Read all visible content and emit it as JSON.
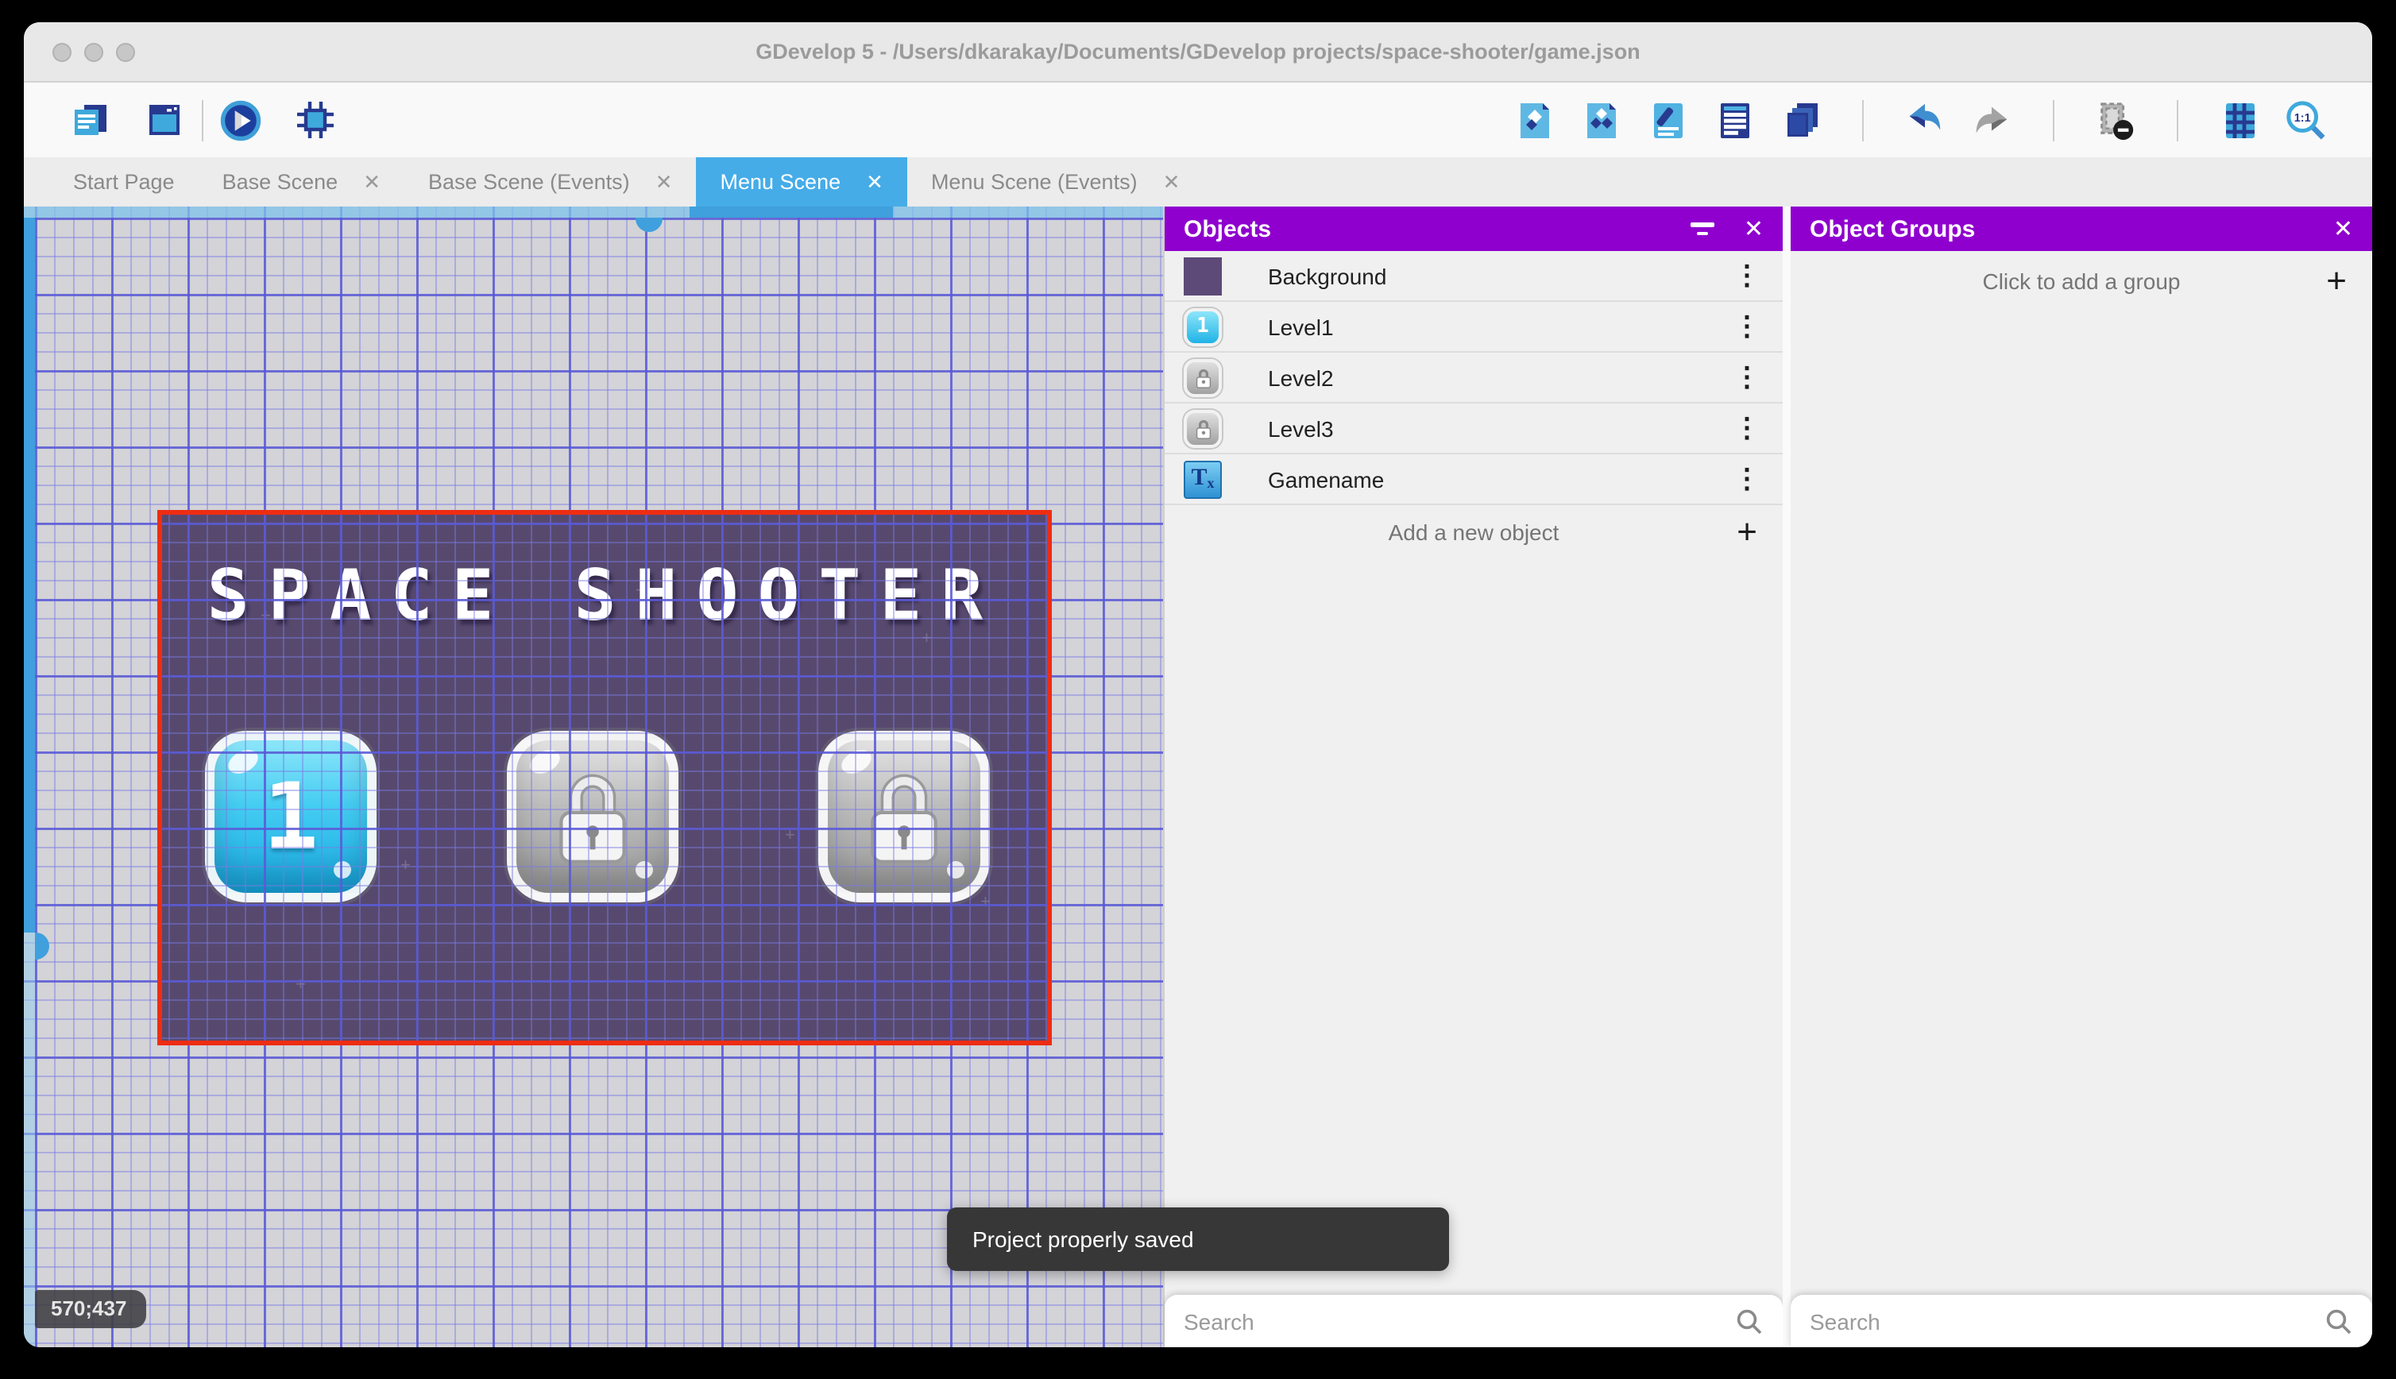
{
  "window": {
    "title": "GDevelop 5 - /Users/dkarakay/Documents/GDevelop projects/space-shooter/game.json"
  },
  "toolbar": {
    "left_icons": [
      "project-manager",
      "scene-window",
      "play",
      "debug"
    ],
    "right_icons": [
      "objects-panel",
      "object-groups-panel",
      "properties",
      "instances-list",
      "layers",
      "undo",
      "redo",
      "remove-instances",
      "grid",
      "zoom-1-1"
    ]
  },
  "tabs": [
    {
      "label": "Start Page",
      "closable": false,
      "active": false
    },
    {
      "label": "Base Scene",
      "closable": true,
      "active": false
    },
    {
      "label": "Base Scene (Events)",
      "closable": true,
      "active": false
    },
    {
      "label": "Menu Scene",
      "closable": true,
      "active": true
    },
    {
      "label": "Menu Scene (Events)",
      "closable": true,
      "active": false
    }
  ],
  "canvas": {
    "cursor_coordinates": "570;437",
    "scene": {
      "title": "SPACE SHOOTER",
      "level_buttons": [
        {
          "label": "1",
          "state": "unlocked"
        },
        {
          "label": "",
          "state": "locked"
        },
        {
          "label": "",
          "state": "locked"
        }
      ]
    }
  },
  "objects_panel": {
    "title": "Objects",
    "items": [
      {
        "name": "Background",
        "thumb": "purple-swatch",
        "thumb_label": ""
      },
      {
        "name": "Level1",
        "thumb": "blue-button",
        "thumb_label": "1"
      },
      {
        "name": "Level2",
        "thumb": "gray-lock-button",
        "thumb_label": ""
      },
      {
        "name": "Level3",
        "thumb": "gray-lock-button",
        "thumb_label": ""
      },
      {
        "name": "Gamename",
        "thumb": "text-object",
        "thumb_label": "T"
      }
    ],
    "add_label": "Add a new object",
    "search_placeholder": "Search"
  },
  "groups_panel": {
    "title": "Object Groups",
    "empty_label": "Click to add a group",
    "search_placeholder": "Search"
  },
  "toast": {
    "message": "Project properly saved"
  },
  "glyphs": {
    "close": "✕",
    "plus": "+",
    "kebab": "⋮"
  },
  "colors": {
    "accent_purple": "#8f00ce",
    "tab_active_blue": "#45ace8",
    "selection_red": "#ee2d12",
    "scene_purple": "#57496e",
    "toolbar_blue": "#3fa9dc",
    "toolbar_navy": "#273a8f"
  }
}
